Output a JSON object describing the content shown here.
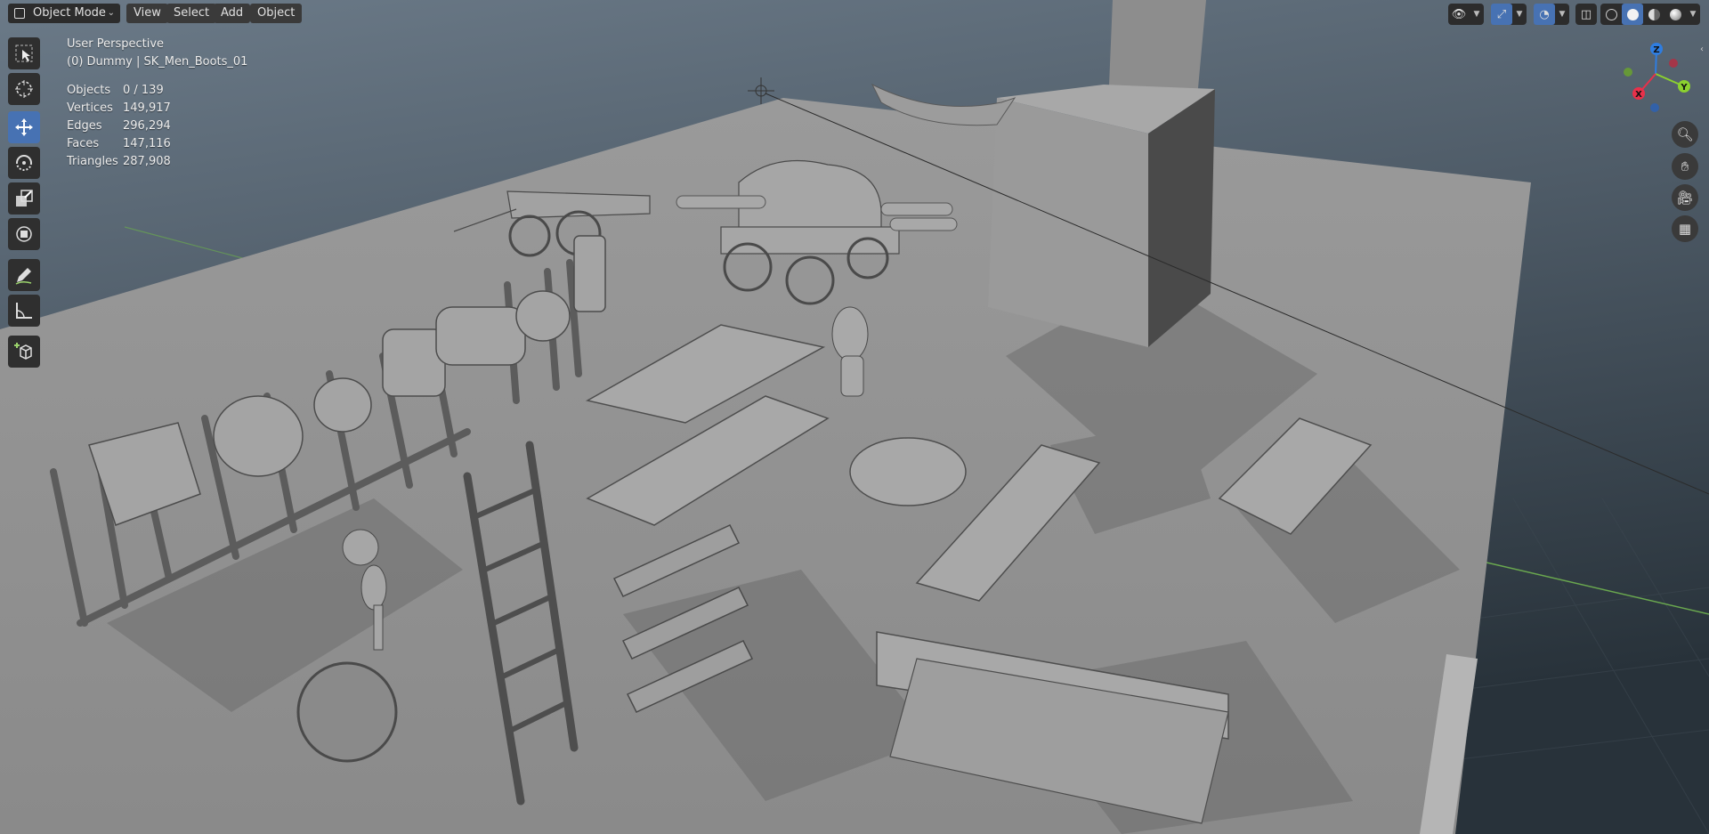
{
  "header": {
    "mode_label": "Object Mode",
    "menus": [
      "View",
      "Select",
      "Add",
      "Object"
    ]
  },
  "overlay": {
    "view_name": "User Perspective",
    "active_object": "(0) Dummy | SK_Men_Boots_01",
    "stats": [
      {
        "label": "Objects",
        "value": "0 / 139"
      },
      {
        "label": "Vertices",
        "value": "149,917"
      },
      {
        "label": "Edges",
        "value": "296,294"
      },
      {
        "label": "Faces",
        "value": "147,116"
      },
      {
        "label": "Triangles",
        "value": "287,908"
      }
    ]
  },
  "toolbar": {
    "tools": [
      {
        "name": "select-box-tool",
        "icon": "select-box-icon",
        "active": false
      },
      {
        "name": "cursor-tool",
        "icon": "cursor-icon",
        "active": false
      },
      {
        "name": "move-tool",
        "icon": "move-icon",
        "active": true
      },
      {
        "name": "rotate-tool",
        "icon": "rotate-icon",
        "active": false
      },
      {
        "name": "scale-tool",
        "icon": "scale-icon",
        "active": false
      },
      {
        "name": "transform-tool",
        "icon": "transform-icon",
        "active": false
      },
      {
        "name": "annotate-tool",
        "icon": "annotate-icon",
        "active": false
      },
      {
        "name": "measure-tool",
        "icon": "measure-icon",
        "active": false
      },
      {
        "name": "add-cube-tool",
        "icon": "add-cube-icon",
        "active": false
      }
    ]
  },
  "gizmo": {
    "axes": [
      {
        "label": "Z",
        "color": "#2f7de0"
      },
      {
        "label": "Y",
        "color": "#8bd12f"
      },
      {
        "label": "X",
        "color": "#e8304a"
      }
    ]
  },
  "nav_buttons": [
    "zoom-icon",
    "pan-hand-icon",
    "camera-icon",
    "ortho-grid-icon"
  ],
  "colors": {
    "accent": "#4772b3",
    "header_bg": "#2c2c2c",
    "floor": "#8e8e8e",
    "background": "#4a5560"
  }
}
